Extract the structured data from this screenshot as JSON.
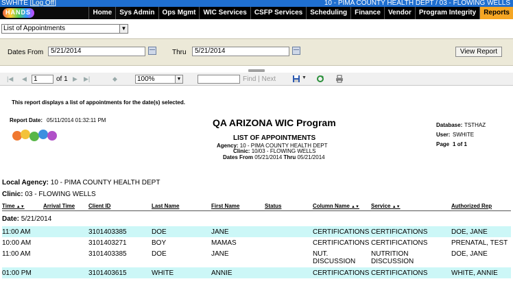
{
  "topbar": {
    "user": "SWHITE",
    "logoff": "Log Off",
    "site": "10 - PIMA COUNTY HEALTH DEPT / 03 - FLOWING WELLS"
  },
  "logo": {
    "text": "HANDS"
  },
  "nav": [
    "Home",
    "Sys Admin",
    "Ops Mgmt",
    "WIC Services",
    "CSFP Services",
    "Scheduling",
    "Finance",
    "Vendor",
    "Program Integrity",
    "Reports"
  ],
  "report_select": {
    "value": "List of Appointments"
  },
  "params": {
    "from_label": "Dates From",
    "from_value": "5/21/2014",
    "thru_label": "Thru",
    "thru_value": "5/21/2014",
    "view_button": "View Report"
  },
  "toolbar": {
    "page": "1",
    "of": "of 1",
    "zoom": "100%",
    "find": "Find",
    "next": "Next"
  },
  "report": {
    "description": "This report displays a list of appointments for the date(s) selected.",
    "report_date_label": "Report Date:",
    "report_date_value": "05/11/2014  01:32:11 PM",
    "title": "QA ARIZONA WIC Program",
    "subtitle": "LIST OF APPOINTMENTS",
    "agency_label": "Agency:",
    "agency_value": "10 - PIMA COUNTY HEALTH DEPT",
    "clinic_label": "Clinic:",
    "clinic_value": "10/03 - FLOWING WELLS",
    "dates_from_label": "Dates From",
    "dates_from_value": "05/21/2014",
    "thru_label": "Thru",
    "thru_value": "05/21/2014",
    "database_label": "Database:",
    "database_value": "TSTHAZ",
    "user_label": "User:",
    "user_value": "SWHITE",
    "page_label": "Page",
    "page_value": "1",
    "page_of": "of",
    "page_total": "1",
    "local_agency_label": "Local Agency:",
    "local_agency_value": "10 - PIMA COUNTY HEALTH DEPT",
    "clinic_group_label": "Clinic:",
    "clinic_group_value": "03 - FLOWING WELLS",
    "columns": [
      "Time",
      "Arrival Time",
      "Client ID",
      "Last Name",
      "First Name",
      "Status",
      "Column Name",
      "Service",
      "Authorized Rep"
    ],
    "date_label": "Date:",
    "date_value": "5/21/2014",
    "rows": [
      {
        "time": "11:00 AM",
        "arrival": "",
        "client_id": "3101403385",
        "last": "DOE",
        "first": "JANE",
        "status": "",
        "column": "CERTIFICATIONS",
        "service": "CERTIFICATIONS",
        "rep": "DOE, JANE"
      },
      {
        "time": "10:00 AM",
        "arrival": "",
        "client_id": "3101403271",
        "last": "BOY",
        "first": "MAMAS",
        "status": "",
        "column": "CERTIFICATIONS",
        "service": "CERTIFICATIONS",
        "rep": "PRENATAL, TEST"
      },
      {
        "time": "11:00 AM",
        "arrival": "",
        "client_id": "3101403385",
        "last": "DOE",
        "first": "JANE",
        "status": "",
        "column": "NUT. DISCUSSION",
        "service": "NUTRITION DISCUSSION",
        "rep": "DOE, JANE"
      },
      {
        "time": "01:00 PM",
        "arrival": "",
        "client_id": "3101403615",
        "last": "WHITE",
        "first": "ANNIE",
        "status": "",
        "column": "CERTIFICATIONS",
        "service": "CERTIFICATIONS",
        "rep": "WHITE, ANNIE"
      }
    ]
  }
}
